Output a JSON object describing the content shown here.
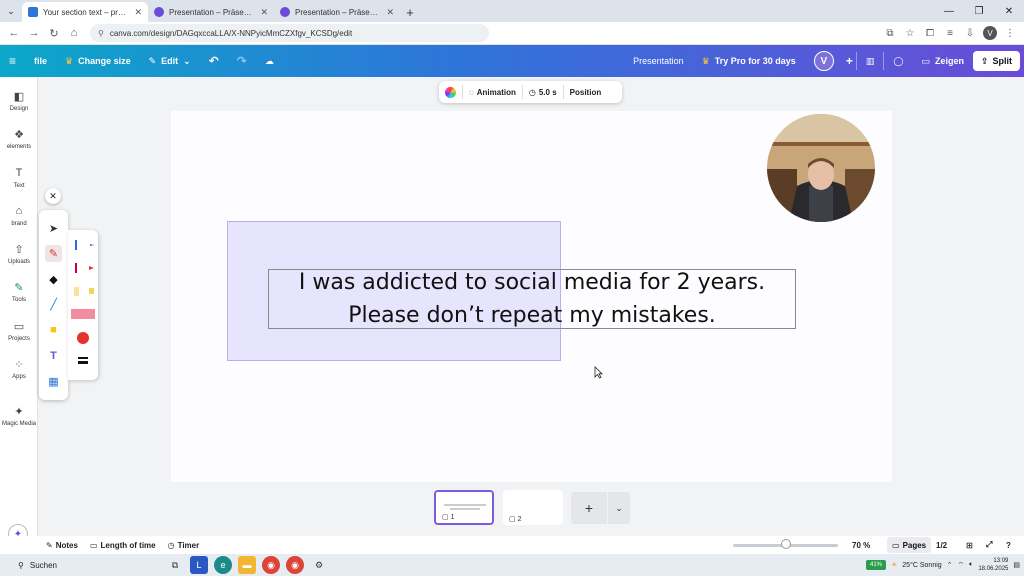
{
  "browser": {
    "tabs": [
      {
        "title": "Your section text – presentation",
        "active": true,
        "color": "#2f74d9"
      },
      {
        "title": "Presentation – Präsentation – C",
        "active": false,
        "color": "#6a4cd8"
      },
      {
        "title": "Presentation – Präsentation – C",
        "active": false,
        "color": "#6a4cd8"
      }
    ],
    "url": "canva.com/design/DAGqxccaLLA/X-NNPyicMmCZXfgv_KCSDg/edit"
  },
  "canva_bar": {
    "file": "file",
    "change_size": "Change size",
    "edit": "Edit",
    "doc_title": "Presentation",
    "try_pro": "Try Pro for 30 days",
    "avatar_letter": "V",
    "present": "Zeigen",
    "share": "Split"
  },
  "left_rail": {
    "items": [
      {
        "label": "Design",
        "icon": "design-icon"
      },
      {
        "label": "elements",
        "icon": "elements-icon"
      },
      {
        "label": "Text",
        "icon": "text-icon"
      },
      {
        "label": "brand",
        "icon": "brand-icon"
      },
      {
        "label": "Uploads",
        "icon": "upload-icon"
      },
      {
        "label": "Tools",
        "icon": "tools-icon"
      },
      {
        "label": "Projects",
        "icon": "folder-icon"
      },
      {
        "label": "Apps",
        "icon": "apps-icon"
      },
      {
        "label": "Magic Media",
        "icon": "magic-media-icon"
      }
    ]
  },
  "context_bar": {
    "animation": "Animation",
    "duration": "5.0 s",
    "position": "Position"
  },
  "slide": {
    "text": "I was addicted to social media for 2 years. Please don’t repeat my mistakes.",
    "shape_color": "#d6d0fc"
  },
  "pages": {
    "thumb1_label": "1",
    "thumb2_label": "2"
  },
  "footer": {
    "notes": "Notes",
    "length": "Length of time",
    "timer": "Timer",
    "zoom": "70 %",
    "zoom_level": 0.7,
    "pages": "Pages",
    "page_count": "1/2"
  },
  "taskbar": {
    "search": "Suchen",
    "weather": "25°C Sonnig",
    "battery": "41%",
    "time": "13:09",
    "date": "18.06.2025"
  }
}
